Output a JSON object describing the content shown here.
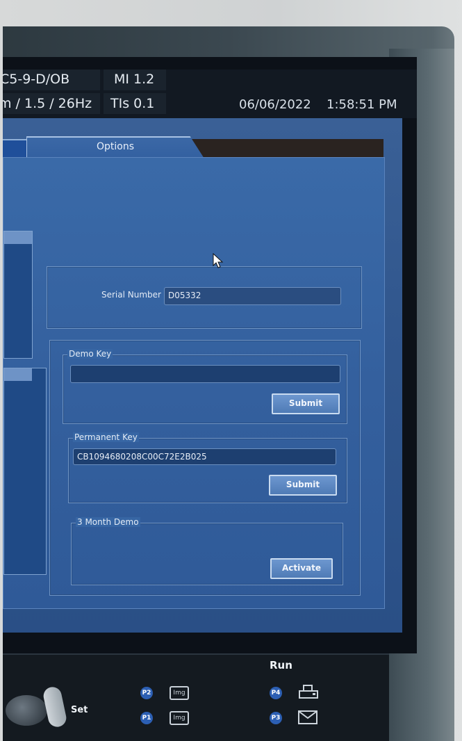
{
  "status_bar": {
    "probe": "C5-9-D/OB",
    "mode": "m / 1.5 / 26Hz",
    "mi": "MI 1.2",
    "tis": "TIs 0.1",
    "date": "06/06/2022",
    "time": "1:58:51 PM"
  },
  "tabs": {
    "active": "Options"
  },
  "serial": {
    "label": "Serial Number",
    "value": "D05332"
  },
  "demo_key": {
    "legend": "Demo Key",
    "value": "",
    "submit_label": "Submit"
  },
  "permanent_key": {
    "legend": "Permanent Key",
    "value": "CB1094680208C00C72E2B025",
    "submit_label": "Submit"
  },
  "three_month_demo": {
    "legend": "3 Month Demo",
    "activate_label": "Activate"
  },
  "console": {
    "run_label": "Run",
    "set_label": "Set",
    "p1": "P1",
    "p2": "P2",
    "p3": "P3",
    "p4": "P4",
    "img_label": "Img"
  }
}
